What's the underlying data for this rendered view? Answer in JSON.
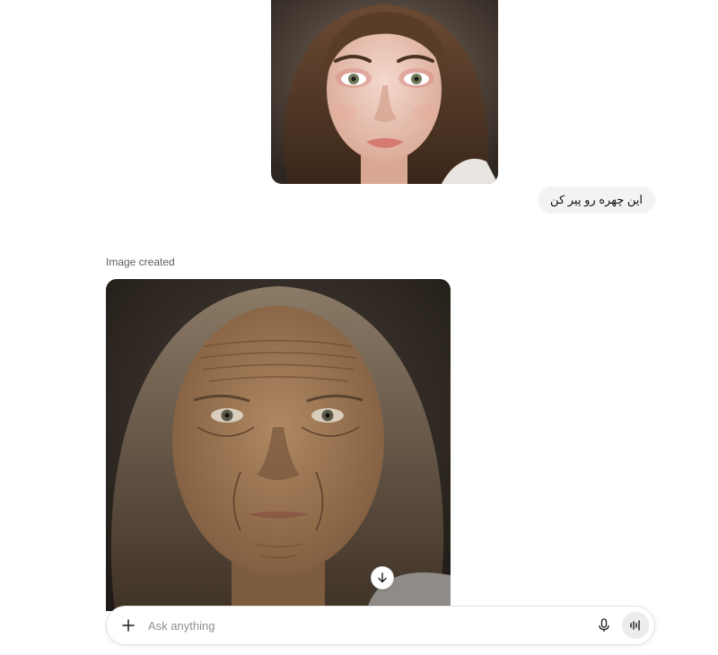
{
  "conversation": {
    "user_message": {
      "image_alt": "young woman portrait",
      "text": "این چهره رو پیر کن"
    },
    "assistant_message": {
      "status": "Image created",
      "image_alt": "aged woman portrait"
    }
  },
  "composer": {
    "placeholder": "Ask anything"
  },
  "icons": {
    "plus": "plus-icon",
    "mic": "microphone-icon",
    "voice": "voice-waveform-icon",
    "scroll": "arrow-down-icon"
  }
}
